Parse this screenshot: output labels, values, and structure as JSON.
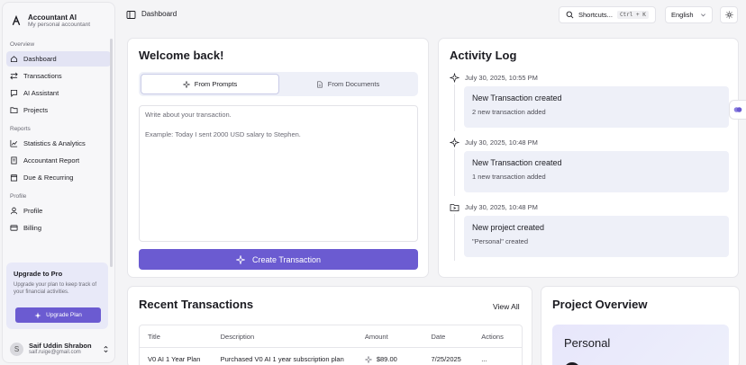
{
  "brand": {
    "title": "Accountant AI",
    "subtitle": "My personal accountant"
  },
  "sidebar": {
    "overview_label": "Overview",
    "overview_items": [
      {
        "label": "Dashboard",
        "icon": "home-icon",
        "active": true
      },
      {
        "label": "Transactions",
        "icon": "arrows-icon"
      },
      {
        "label": "AI Assistant",
        "icon": "message-icon"
      },
      {
        "label": "Projects",
        "icon": "folder-icon"
      }
    ],
    "reports_label": "Reports",
    "reports_items": [
      {
        "label": "Statistics & Analytics",
        "icon": "chart-icon"
      },
      {
        "label": "Accountant Report",
        "icon": "report-icon"
      },
      {
        "label": "Due & Recurring",
        "icon": "calendar-icon"
      }
    ],
    "profile_label": "Profile",
    "profile_items": [
      {
        "label": "Profile",
        "icon": "user-icon"
      },
      {
        "label": "Billing",
        "icon": "card-icon"
      }
    ],
    "upgrade": {
      "title": "Upgrade to Pro",
      "description": "Upgrade your plan to keep track of your financial activities.",
      "button": "Upgrade Plan"
    },
    "user": {
      "initial": "S",
      "name": "Saif Uddin Shrabon",
      "email": "saif.ruige@gmail.com"
    }
  },
  "header": {
    "breadcrumb": "Dashboard",
    "shortcuts_label": "Shortcuts...",
    "shortcuts_kbd": "Ctrl + K",
    "language": "English"
  },
  "welcome": {
    "title": "Welcome back!",
    "tabs": [
      "From Prompts",
      "From Documents"
    ],
    "placeholder_line1": "Write about your transaction.",
    "placeholder_line2": "Example: Today I sent 2000 USD salary to Stephen.",
    "create_button": "Create Transaction"
  },
  "activity": {
    "title": "Activity Log",
    "entries": [
      {
        "time": "July 30, 2025, 10:55 PM",
        "title": "New Transaction created",
        "desc": "2 new transaction added",
        "icon": "sparkles-icon"
      },
      {
        "time": "July 30, 2025, 10:48 PM",
        "title": "New Transaction created",
        "desc": "1 new transaction added",
        "icon": "sparkles-icon"
      },
      {
        "time": "July 30, 2025, 10:48 PM",
        "title": "New project created",
        "desc": "\"Personal\" created",
        "icon": "folder-icon"
      }
    ]
  },
  "recent": {
    "title": "Recent Transactions",
    "view_all": "View All",
    "columns": [
      "Title",
      "Description",
      "Amount",
      "Date",
      "Actions"
    ],
    "rows": [
      {
        "title": "V0 AI 1 Year Plan",
        "description": "Purchased V0 AI 1 year subscription plan",
        "amount": "$89.00",
        "date": "7/25/2025",
        "actions": "..."
      }
    ]
  },
  "project": {
    "title": "Project Overview",
    "card_name": "Personal"
  },
  "colors": {
    "accent": "#6b5bd1",
    "accent_soft": "#eef0f8"
  }
}
